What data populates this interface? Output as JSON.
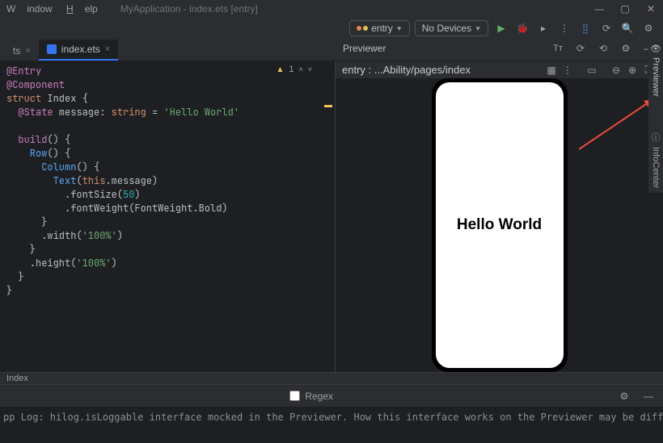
{
  "menu": {
    "window": "Window",
    "help": "Help"
  },
  "title": "MyApplication - index.ets [entry]",
  "toolbar": {
    "module": "entry",
    "device": "No Devices"
  },
  "tabs": {
    "t0": {
      "label": "ts"
    },
    "t1": {
      "label": "index.ets"
    }
  },
  "editor": {
    "l1a": "@Entry",
    "l2a": "@Component",
    "l3a": "struct",
    "l3b": " Index ",
    "l3c": "{",
    "l4a": "  @State",
    "l4b": " message",
    "l4c": ": ",
    "l4d": "string",
    "l4e": " = ",
    "l4f": "'Hello World'",
    "l6a": "  build",
    "l6b": "() {",
    "l7a": "    Row",
    "l7b": "() {",
    "l8a": "      Column",
    "l8b": "() {",
    "l9a": "        Text",
    "l9b": "(",
    "l9c": "this",
    "l9d": ".message)",
    "l10a": "          .fontSize(",
    "l10b": "50",
    "l10c": ")",
    "l11a": "          .fontWeight(FontWeight.Bold)",
    "l12a": "      }",
    "l13a": "      .width(",
    "l13b": "'100%'",
    "l13c": ")",
    "l14a": "    }",
    "l15a": "    .height(",
    "l15b": "'100%'",
    "l15c": ")",
    "l16a": "  }",
    "l17a": "}",
    "warnCount": "1"
  },
  "crumb": "Index",
  "previewer": {
    "title": "Previewer",
    "path": "entry : ...Ability/pages/index",
    "text": "Hello World"
  },
  "rightTabs": {
    "previewer": "Previewer",
    "info": "InfoCenter"
  },
  "bottom": {
    "regex": "Regex"
  },
  "console": {
    "l1": "pp Log: hilog.isLoggable interface mocked in the Previewer. How this interface works on the Previewer may be different from that on",
    "l2": ""
  }
}
